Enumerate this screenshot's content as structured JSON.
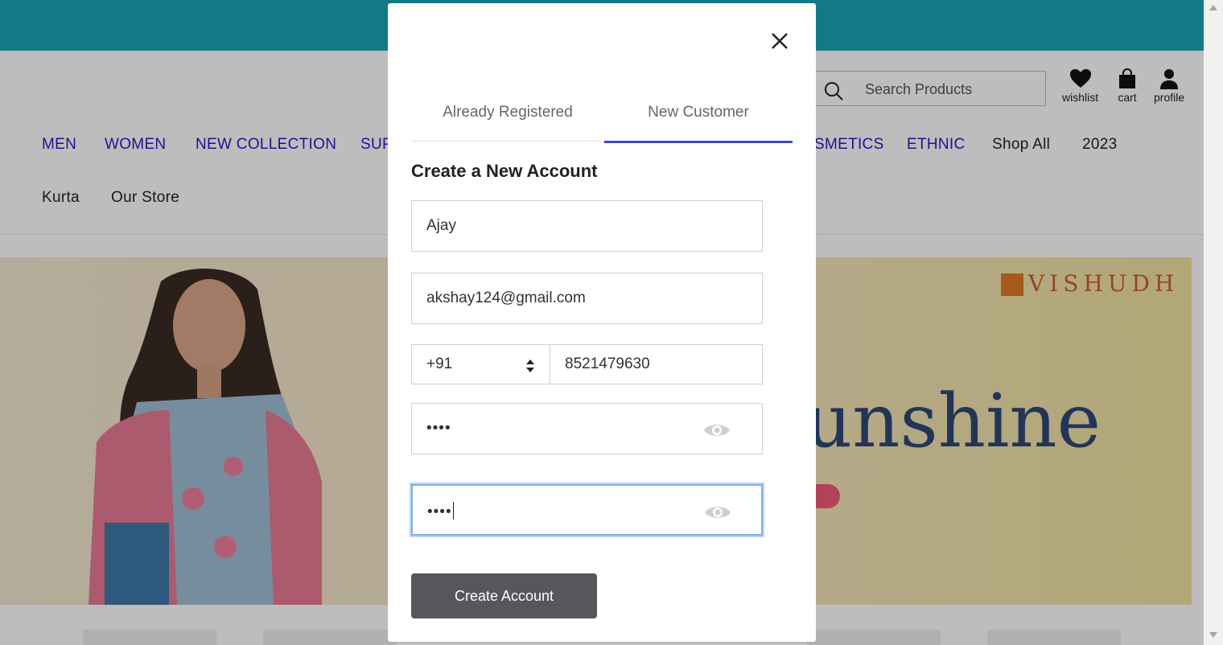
{
  "header": {
    "search_placeholder": "Search Products",
    "icons": [
      {
        "label": "wishlist",
        "icon": "heart-icon"
      },
      {
        "label": "cart",
        "icon": "bag-icon"
      },
      {
        "label": "profile",
        "icon": "person-icon"
      }
    ]
  },
  "nav": {
    "row1_left": [
      "MEN",
      "WOMEN",
      "NEW COLLECTION",
      "SUP"
    ],
    "row1_right": [
      "SMETICS",
      "ETHNIC",
      "Shop All",
      "2023"
    ],
    "row2": [
      "Kurta",
      "Our Store"
    ]
  },
  "banner": {
    "brand": "VISHUDH",
    "headline": "unshine"
  },
  "modal": {
    "tabs": [
      "Already Registered",
      "New Customer"
    ],
    "active_tab": "New Customer",
    "title": "Create a New Account",
    "name_value": "Ajay",
    "email_value": "akshay124@gmail.com",
    "country_code": "+91",
    "phone_value": "8521479630",
    "password_mask": "••••",
    "confirm_password_mask": "••••",
    "submit_label": "Create Account"
  }
}
